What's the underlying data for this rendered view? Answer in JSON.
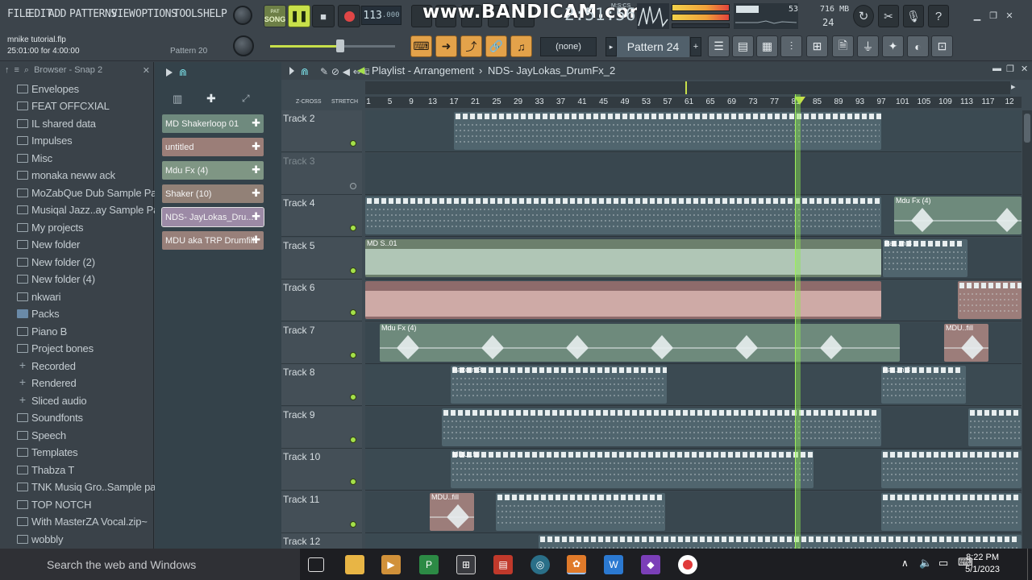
{
  "menu": [
    "FILE",
    "EDIT",
    "ADD",
    "PATTERNS",
    "VIEW",
    "OPTIONS",
    "TOOLS",
    "HELP"
  ],
  "transport": {
    "song_label": "SONG",
    "pat_label": "PAT",
    "tempo": "113",
    "tempo_decimals": ".000",
    "watermark": "www.BANDICAM.com",
    "time": "2:51:56",
    "time_unit": "M:S:CS"
  },
  "stats": {
    "cpu": "53",
    "memory": "716 MB",
    "polyphony": "24"
  },
  "project": {
    "file_name": "mnike tutorial.flp",
    "time_range": "25:01:00 for 4:00:00",
    "hint_pattern": "Pattern 20"
  },
  "toolbar": {
    "selector_value": "(none)",
    "pattern_name": "Pattern 24"
  },
  "browser": {
    "header": "Browser - Snap 2",
    "items": [
      {
        "label": "Envelopes",
        "icon": "folder"
      },
      {
        "label": "FEAT OFFCXIAL",
        "icon": "folder"
      },
      {
        "label": "IL shared data",
        "icon": "folder"
      },
      {
        "label": "Impulses",
        "icon": "folder"
      },
      {
        "label": "Misc",
        "icon": "folder"
      },
      {
        "label": "monaka neww ack",
        "icon": "folder"
      },
      {
        "label": "MoZabQue Dub Sample Pack",
        "icon": "folder"
      },
      {
        "label": "Musiqal Jazz..ay Sample Pack",
        "icon": "folder"
      },
      {
        "label": "My projects",
        "icon": "folder"
      },
      {
        "label": "New folder",
        "icon": "folder"
      },
      {
        "label": "New folder (2)",
        "icon": "folder"
      },
      {
        "label": "New folder (4)",
        "icon": "folder"
      },
      {
        "label": "nkwari",
        "icon": "folder"
      },
      {
        "label": "Packs",
        "icon": "packs"
      },
      {
        "label": "Piano B",
        "icon": "folder"
      },
      {
        "label": "Project bones",
        "icon": "folder"
      },
      {
        "label": "Recorded",
        "icon": "plus"
      },
      {
        "label": "Rendered",
        "icon": "plus"
      },
      {
        "label": "Sliced audio",
        "icon": "plus"
      },
      {
        "label": "Soundfonts",
        "icon": "folder"
      },
      {
        "label": "Speech",
        "icon": "folder"
      },
      {
        "label": "Templates",
        "icon": "folder"
      },
      {
        "label": "Thabza T",
        "icon": "folder"
      },
      {
        "label": "TNK Musiq Gro..Sample pack",
        "icon": "folder"
      },
      {
        "label": "TOP NOTCH",
        "icon": "folder"
      },
      {
        "label": "With MasterZA Vocal.zip~",
        "icon": "folder"
      },
      {
        "label": "wobbly",
        "icon": "folder"
      }
    ]
  },
  "picker": {
    "clips": [
      {
        "label": "MD Shakerloop 01",
        "color": "#6f8a7e"
      },
      {
        "label": "untitled",
        "color": "#9b7e78"
      },
      {
        "label": "Mdu Fx (4)",
        "color": "#7f9684"
      },
      {
        "label": "Shaker (10)",
        "color": "#928177"
      },
      {
        "label": "NDS- JayLokas_Dru...",
        "color": "#9c8aa6"
      },
      {
        "label": "MDU aka TRP Drumfill",
        "color": "#98807a"
      }
    ]
  },
  "playlist": {
    "title": "Playlist - Arrangement",
    "breadcrumb": "NDS- JayLokas_DrumFx_2",
    "zcross": "Z-CROSS",
    "stretch": "STRETCH",
    "ruler": [
      "1",
      "5",
      "9",
      "13",
      "17",
      "21",
      "25",
      "29",
      "33",
      "37",
      "41",
      "45",
      "49",
      "53",
      "57",
      "61",
      "65",
      "69",
      "73",
      "77",
      "81",
      "85",
      "89",
      "93",
      "97",
      "101",
      "105",
      "109",
      "113",
      "117",
      "12"
    ],
    "tracks": [
      {
        "name": "Track 2"
      },
      {
        "name": "Track 3"
      },
      {
        "name": "Track 4"
      },
      {
        "name": "Track 5"
      },
      {
        "name": "Track 6"
      },
      {
        "name": "Track 7"
      },
      {
        "name": "Track 8"
      },
      {
        "name": "Track 9"
      },
      {
        "name": "Track 10"
      },
      {
        "name": "Track 11"
      },
      {
        "name": "Track 12"
      }
    ],
    "clip_labels": {
      "mdu_fx": "Mdu Fx (4)",
      "md_s": "MD S..01",
      "pattern_3": "Pattern 3",
      "pat_rn_3": "Pat..rn 3",
      "mdu_fill": "MDU..fill"
    }
  },
  "taskbar": {
    "search_placeholder": "Search the web and Windows",
    "time": "8:22 PM",
    "date": "5/1/2023"
  }
}
